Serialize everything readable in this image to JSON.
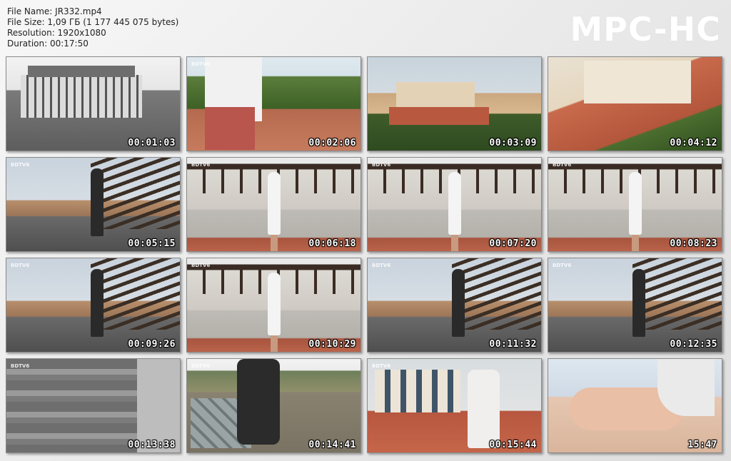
{
  "file_info": {
    "name_line": "File Name: JR332.mp4",
    "size_line": "File Size: 1,09 ГБ (1 177 445 075 bytes)",
    "resolution_line": "Resolution: 1920x1080",
    "duration_line": "Duration: 00:17:50"
  },
  "logo": {
    "text": "MPC-HC",
    "color": "#ffffff"
  },
  "colors": {
    "background": "#ececec",
    "timestamp": "#ffffff",
    "border": "#8a8a8a"
  },
  "thumbnails": [
    {
      "time": "00:01:03",
      "scene": "bw-villa",
      "watermark": ""
    },
    {
      "time": "00:02:06",
      "scene": "rooftop-legs",
      "watermark": "BDTV6"
    },
    {
      "time": "00:03:09",
      "scene": "villa-wide",
      "watermark": ""
    },
    {
      "time": "00:04:12",
      "scene": "aerial-villa",
      "watermark": ""
    },
    {
      "time": "00:05:15",
      "scene": "pergola-side",
      "watermark": "BDTV6"
    },
    {
      "time": "00:06:18",
      "scene": "pergola-front",
      "watermark": "BDTV6"
    },
    {
      "time": "00:07:20",
      "scene": "pergola-front",
      "watermark": "BDTV6"
    },
    {
      "time": "00:08:23",
      "scene": "pergola-front",
      "watermark": "BDTV6"
    },
    {
      "time": "00:09:26",
      "scene": "pergola-side",
      "watermark": "BDTV6"
    },
    {
      "time": "00:10:29",
      "scene": "pergola-front",
      "watermark": "BDTV6"
    },
    {
      "time": "00:11:32",
      "scene": "pergola-side",
      "watermark": "BDTV6"
    },
    {
      "time": "00:12:35",
      "scene": "pergola-side",
      "watermark": "BDTV6"
    },
    {
      "time": "00:13:38",
      "scene": "stairs",
      "watermark": "BDTV6"
    },
    {
      "time": "00:14:41",
      "scene": "ledge",
      "watermark": "BDTV6"
    },
    {
      "time": "00:15:44",
      "scene": "sitting",
      "watermark": "BDTV6"
    },
    {
      "time": "15:47",
      "scene": "closeup",
      "watermark": ""
    }
  ]
}
